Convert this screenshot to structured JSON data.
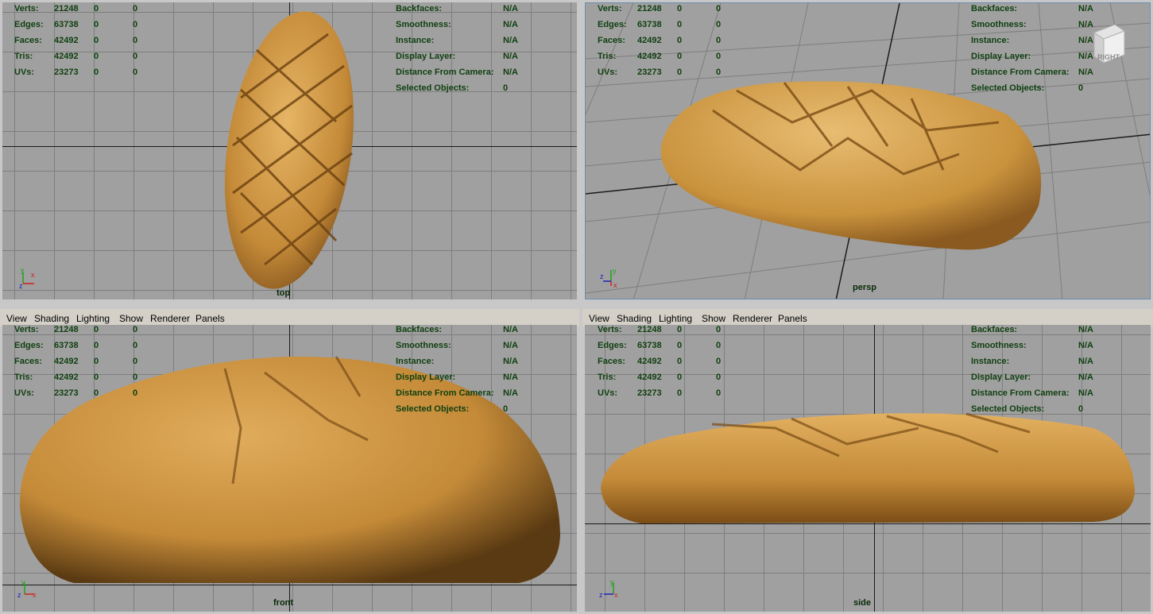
{
  "menu": [
    "View",
    "Shading",
    "Lighting",
    "Show",
    "Renderer",
    "Panels"
  ],
  "stats": {
    "labels": [
      "Verts:",
      "Edges:",
      "Faces:",
      "Tris:",
      "UVs:"
    ],
    "values": [
      [
        "21248",
        "0",
        "0"
      ],
      [
        "63738",
        "0",
        "0"
      ],
      [
        "42492",
        "0",
        "0"
      ],
      [
        "42492",
        "0",
        "0"
      ],
      [
        "23273",
        "0",
        "0"
      ]
    ]
  },
  "info": {
    "labels": [
      "Backfaces:",
      "Smoothness:",
      "Instance:",
      "Display Layer:",
      "Distance From Camera:",
      "Selected Objects:"
    ],
    "values": [
      "N/A",
      "N/A",
      "N/A",
      "N/A",
      "N/A",
      "0"
    ]
  },
  "cameras": {
    "top": "top",
    "persp": "persp",
    "front": "front",
    "side": "side"
  },
  "viewcube": {
    "label": "RIGHT"
  },
  "colors": {
    "viewport_bg": "#a0a0a0",
    "grid": "#7e7e7e",
    "hud_text": "#104010",
    "bread": "#c9923d"
  }
}
